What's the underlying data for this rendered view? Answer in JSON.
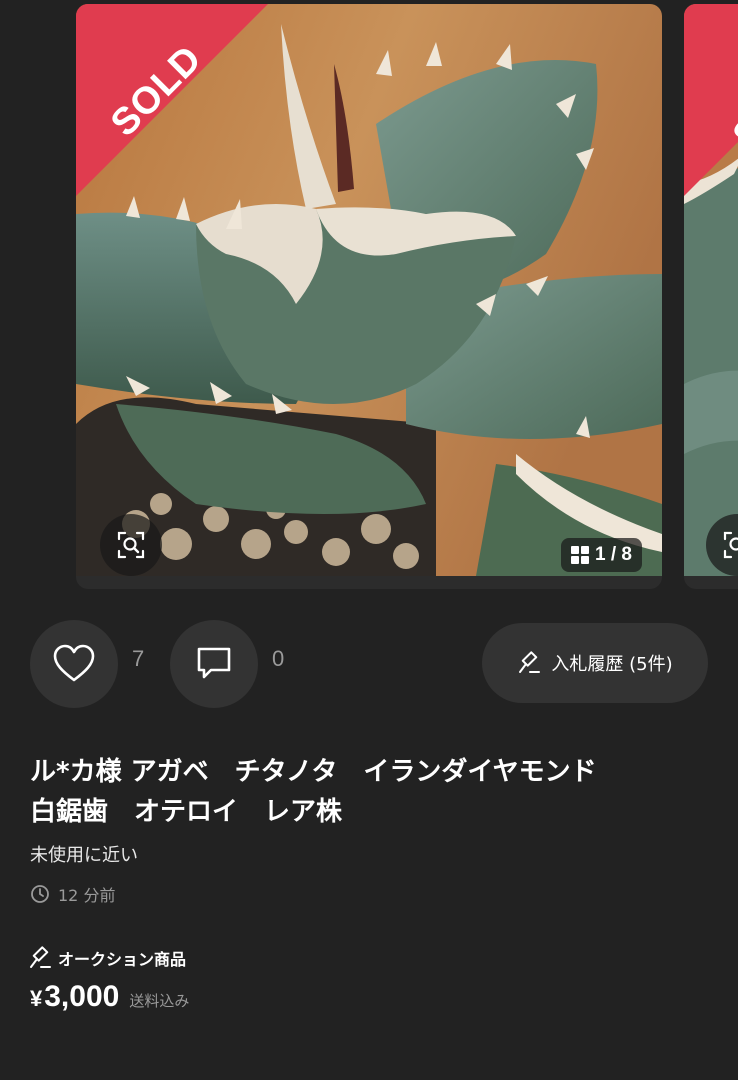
{
  "carousel": {
    "sold_label": "SOLD",
    "image_counter": "1 / 8",
    "icons": {
      "lens": "image-search-icon",
      "grid": "grid-icon"
    }
  },
  "actions": {
    "like_count": "7",
    "comment_count": "0",
    "bid_history_label": "入札履歴 (5件)",
    "icons": {
      "like": "heart-icon",
      "comment": "comment-icon",
      "bid": "gavel-icon"
    }
  },
  "item": {
    "title": "ル*カ様 アガベ　チタノタ　イランダイヤモンド\n白鋸歯　オテロイ　レア株",
    "condition": "未使用に近い",
    "posted_time": "12 分前",
    "auction_label": "オークション商品",
    "price_currency": "¥",
    "price_value": "3,000",
    "shipping_note": "送料込み"
  },
  "colors": {
    "background": "#222222",
    "surface": "#333333",
    "sold_ribbon": "#e03c4f",
    "muted_text": "#9a9a9a"
  }
}
